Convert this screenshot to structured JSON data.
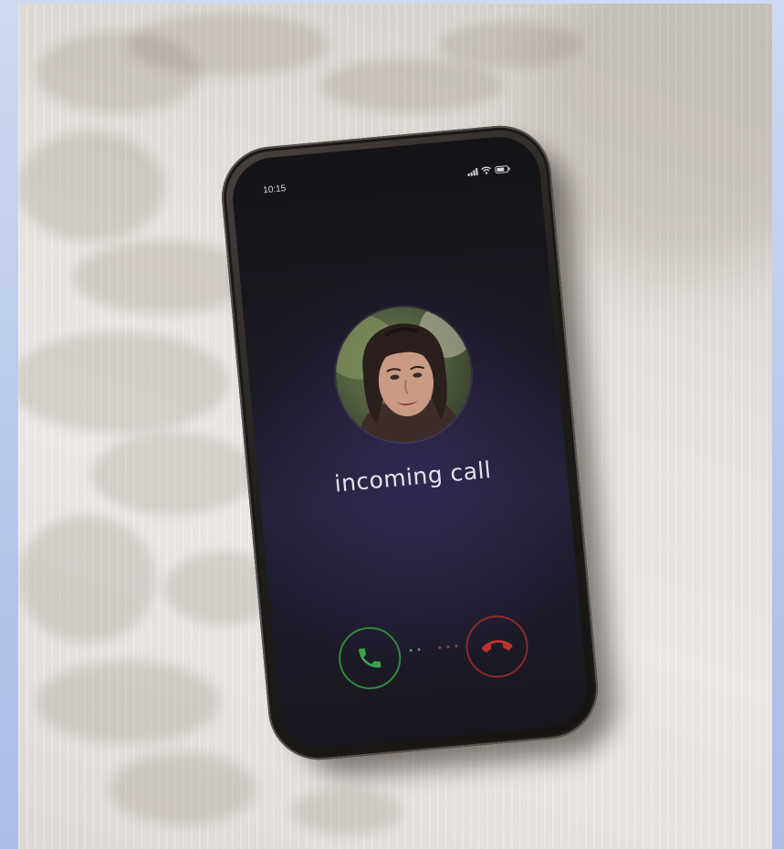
{
  "status_bar": {
    "time": "10:15"
  },
  "call": {
    "label": "incoming call"
  },
  "icons": {
    "accept": "phone-answer-icon",
    "decline": "phone-hangup-icon",
    "signal": "signal-icon",
    "wifi": "wifi-icon",
    "battery": "battery-icon"
  },
  "colors": {
    "accept": "#2f8a3e",
    "decline": "#b52e2e",
    "screen_background": "#1b1a24",
    "label_text": "#e4e3ea"
  }
}
